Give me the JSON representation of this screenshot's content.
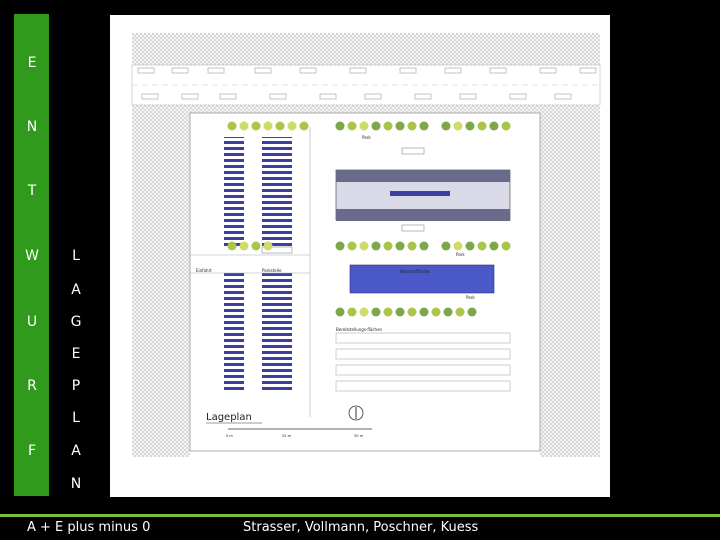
{
  "sidebar": {
    "col1": [
      "E",
      "N",
      "T",
      "W",
      "U",
      "R",
      "F"
    ],
    "col2": [
      "L",
      "A",
      "G",
      "E",
      "P",
      "L",
      "A",
      "N"
    ]
  },
  "plan": {
    "title": "Lageplan",
    "labels": {
      "einfahrt": "Einfahrt",
      "parkstelle": "Parkstelle",
      "wasserfläche": "Wasserfläche",
      "bereitstellungsflaeche": "Bereitstellungs-flächen",
      "park_top": "Park",
      "park_right": "Park",
      "park_mid": "Park",
      "scale_0": "0 m",
      "scale_25": "25 m",
      "scale_50": "50 m"
    }
  },
  "footer": {
    "left": "A + E plus minus 0",
    "right": "Strasser, Vollmann, Poschner, Kuess"
  },
  "colors": {
    "green_bar": "#2f9a1c",
    "footer_rule": "#7fbf3f",
    "water": "#4a58c8",
    "parking_stripe": "#3a3fa0"
  }
}
